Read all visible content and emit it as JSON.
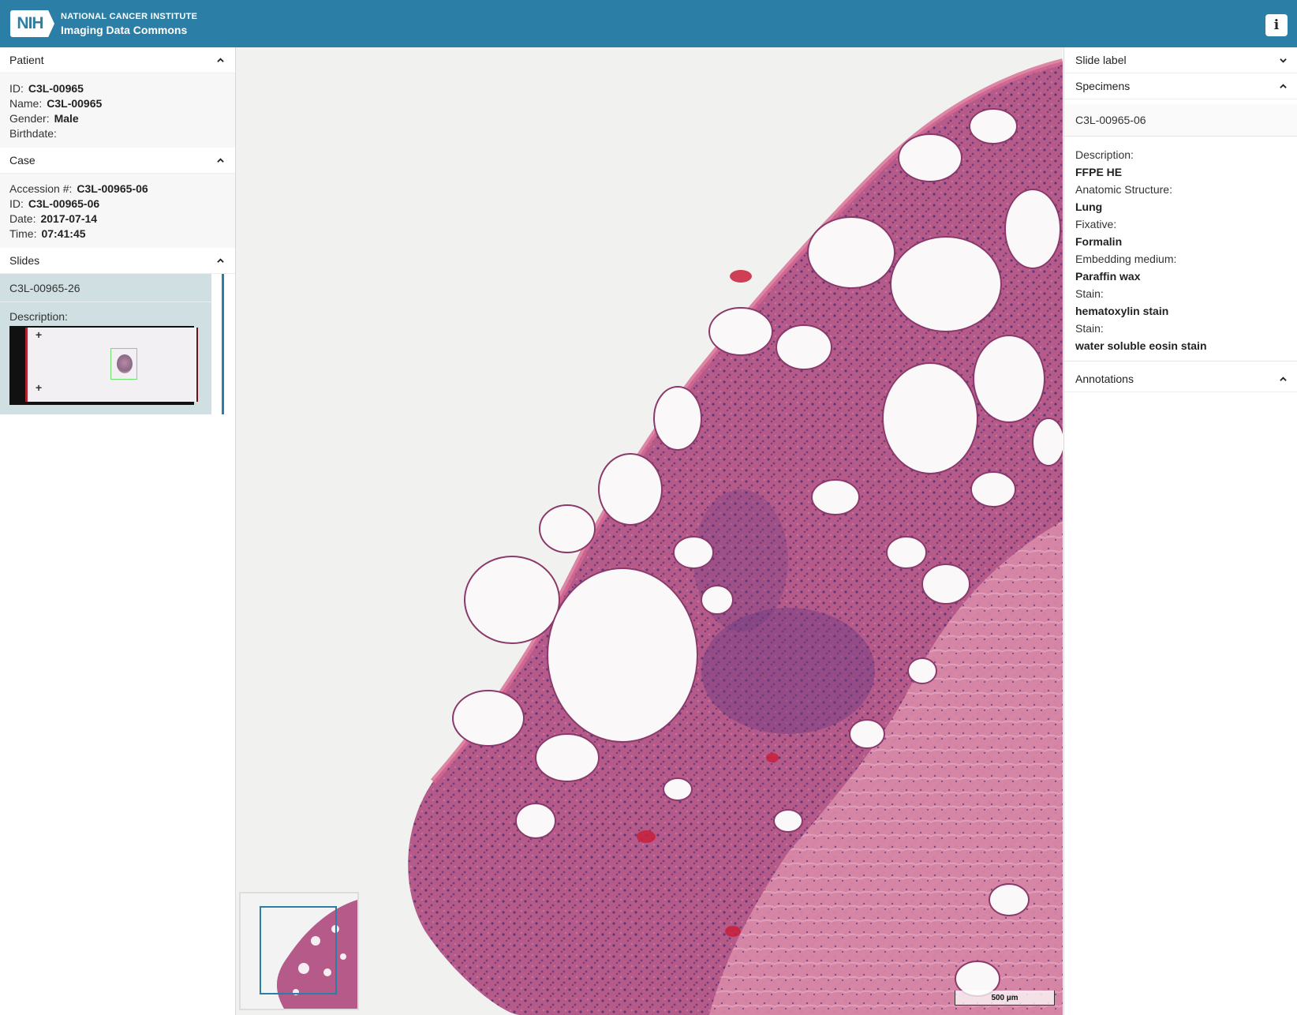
{
  "header": {
    "nih": "NIH",
    "org": "NATIONAL CANCER INSTITUTE",
    "app": "Imaging Data Commons",
    "info_icon": "info-icon",
    "info_glyph": "i"
  },
  "patient": {
    "title": "Patient",
    "rows": [
      {
        "label": "ID",
        "value": "C3L-00965"
      },
      {
        "label": "Name",
        "value": "C3L-00965"
      },
      {
        "label": "Gender",
        "value": "Male"
      },
      {
        "label": "Birthdate",
        "value": ""
      }
    ]
  },
  "case": {
    "title": "Case",
    "rows": [
      {
        "label": "Accession #",
        "value": "C3L-00965-06"
      },
      {
        "label": "ID",
        "value": "C3L-00965-06"
      },
      {
        "label": "Date",
        "value": "2017-07-14"
      },
      {
        "label": "Time",
        "value": "07:41:45"
      }
    ]
  },
  "slides": {
    "title": "Slides",
    "item": "C3L-00965-26",
    "description_label": "Description"
  },
  "viewer": {
    "scale": "500 µm"
  },
  "right": {
    "slide_label": "Slide label",
    "specimens_title": "Specimens",
    "specimen_id": "C3L-00965-06",
    "specimen_fields": [
      {
        "label": "Description",
        "value": "FFPE HE"
      },
      {
        "label": "Anatomic Structure",
        "value": "Lung"
      },
      {
        "label": "Fixative",
        "value": "Formalin"
      },
      {
        "label": "Embedding medium",
        "value": "Paraffin wax"
      },
      {
        "label": "Stain",
        "value": "hematoxylin stain"
      },
      {
        "label": "Stain",
        "value": "water soluble eosin stain"
      }
    ],
    "annotations_title": "Annotations"
  },
  "colors": {
    "header": "#2b7ea6",
    "selected_slide": "#cfdfe2",
    "tissue": "#a8477a"
  }
}
